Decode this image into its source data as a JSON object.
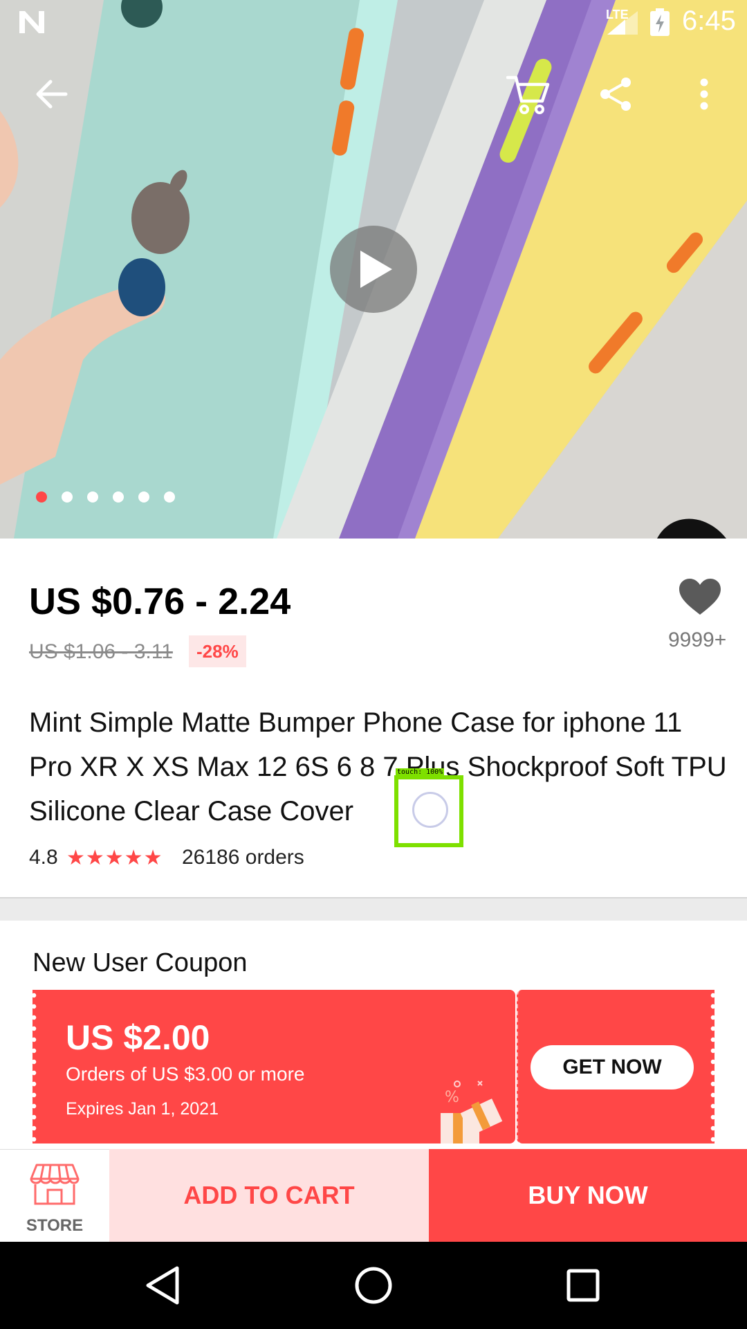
{
  "status_bar": {
    "network": "LTE",
    "time": "6:45"
  },
  "gallery": {
    "slide_count": 6,
    "active_slide": 1
  },
  "product": {
    "price": "US $0.76 - 2.24",
    "original_price": "US $1.06 - 3.11",
    "discount": "-28%",
    "wishlist_count": "9999+",
    "title": "Mint Simple Matte Bumper Phone Case for iphone 11 Pro XR X XS Max 12 6S 6 8 7 Plus Shockproof Soft TPU Silicone Clear Case Cover",
    "rating": "4.8",
    "stars": "★★★★★",
    "orders": "26186 orders"
  },
  "touch_indicator": {
    "label": "touch: 100%"
  },
  "coupon": {
    "heading": "New User Coupon",
    "amount": "US $2.00",
    "condition": "Orders of US $3.00 or more",
    "expires": "Expires Jan 1, 2021",
    "button": "GET NOW"
  },
  "actions": {
    "store": "STORE",
    "add_to_cart": "ADD TO CART",
    "buy_now": "BUY NOW"
  },
  "colors": {
    "accent": "#ff4747",
    "accent_light": "#ffe0e0"
  }
}
